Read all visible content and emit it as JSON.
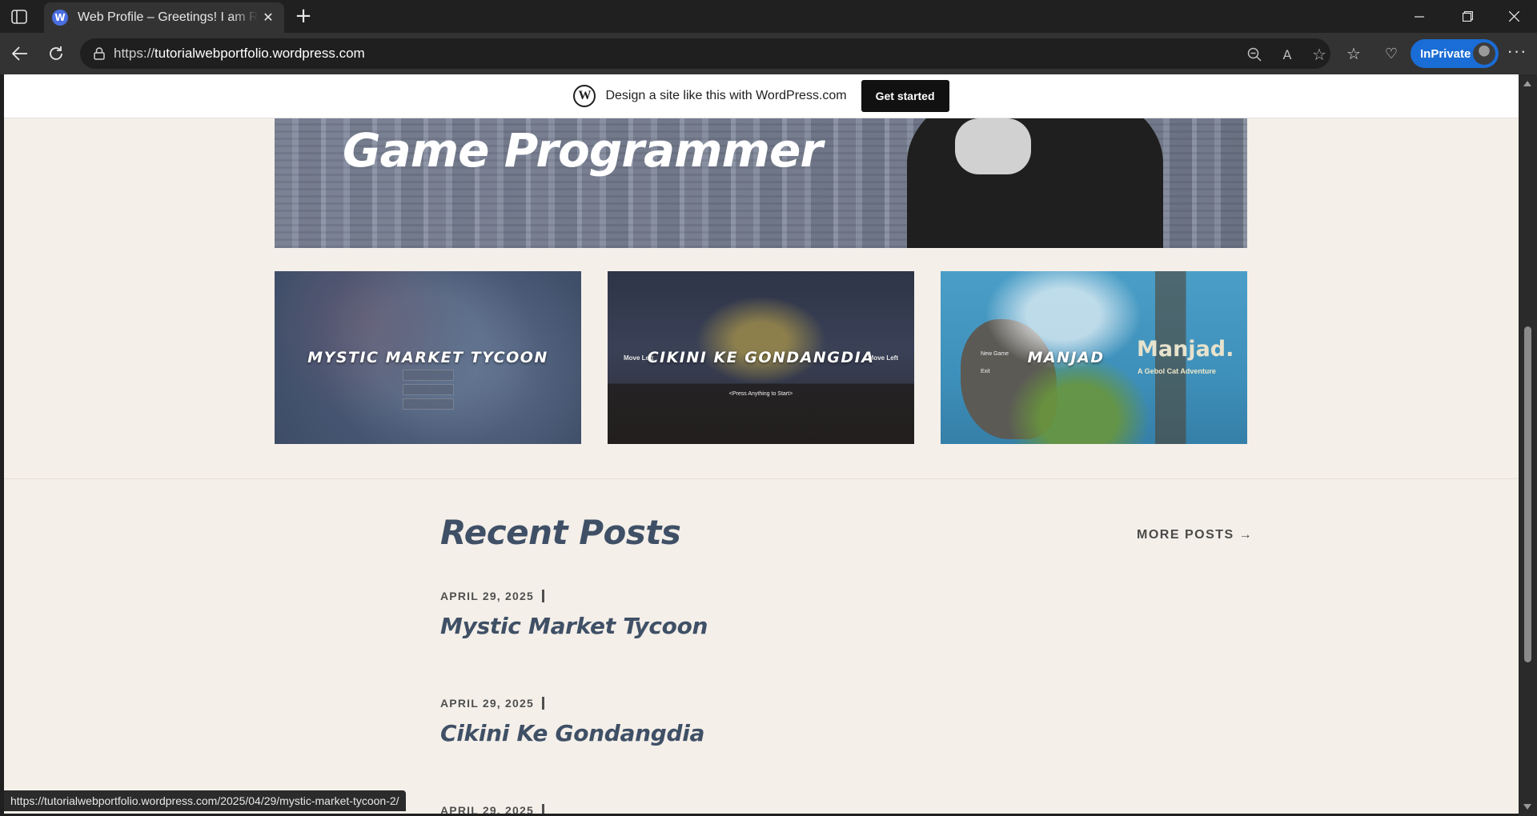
{
  "browser": {
    "tab_title": "Web Profile – Greetings! I am Rifki",
    "url_prefix": "https://",
    "url_domain": "tutorialwebportfolio.wordpress.com",
    "inprivate_label": "InPrivate",
    "status_url": "https://tutorialwebportfolio.wordpress.com/2025/04/29/mystic-market-tycoon-2/"
  },
  "wp_banner": {
    "text": "Design a site like this with WordPress.com",
    "button": "Get started"
  },
  "hero": {
    "title": "Game Programmer"
  },
  "projects": [
    {
      "label": "MYSTIC MARKET TYCOON"
    },
    {
      "label": "CIKINI KE GONDANGDIA",
      "left_hint": "Move Left",
      "right_hint": "Move Left",
      "prompt": "<Press Anything to Start>"
    },
    {
      "label": "MANJAD",
      "brand": "Manjad.",
      "brand_sub": "A Gebol Cat Adventure",
      "menu_new": "New Game",
      "menu_exit": "Exit"
    }
  ],
  "recent_posts": {
    "title": "Recent Posts",
    "more_link": "MORE POSTS →",
    "posts": [
      {
        "date": "APRIL 29, 2025",
        "title": "Mystic Market Tycoon"
      },
      {
        "date": "APRIL 29, 2025",
        "title": "Cikini Ke Gondangdia"
      },
      {
        "date": "APRIL 29, 2025"
      }
    ]
  },
  "colors": {
    "page_bg": "#f4efe9",
    "heading": "#3f5066",
    "inprivate": "#1a6dd6"
  }
}
